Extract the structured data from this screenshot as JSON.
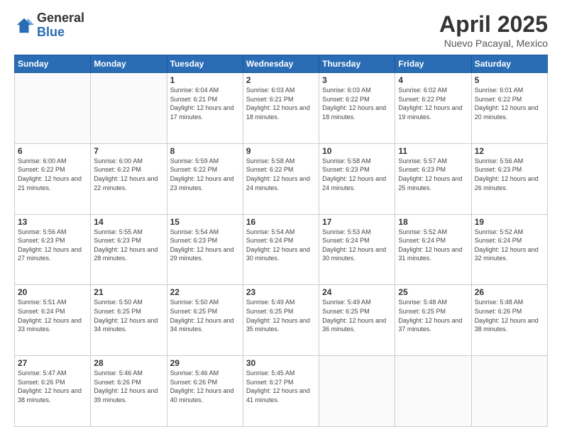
{
  "header": {
    "logo_general": "General",
    "logo_blue": "Blue",
    "main_title": "April 2025",
    "subtitle": "Nuevo Pacayal, Mexico"
  },
  "days_of_week": [
    "Sunday",
    "Monday",
    "Tuesday",
    "Wednesday",
    "Thursday",
    "Friday",
    "Saturday"
  ],
  "weeks": [
    [
      {
        "day": "",
        "info": ""
      },
      {
        "day": "",
        "info": ""
      },
      {
        "day": "1",
        "info": "Sunrise: 6:04 AM\nSunset: 6:21 PM\nDaylight: 12 hours and 17 minutes."
      },
      {
        "day": "2",
        "info": "Sunrise: 6:03 AM\nSunset: 6:21 PM\nDaylight: 12 hours and 18 minutes."
      },
      {
        "day": "3",
        "info": "Sunrise: 6:03 AM\nSunset: 6:22 PM\nDaylight: 12 hours and 18 minutes."
      },
      {
        "day": "4",
        "info": "Sunrise: 6:02 AM\nSunset: 6:22 PM\nDaylight: 12 hours and 19 minutes."
      },
      {
        "day": "5",
        "info": "Sunrise: 6:01 AM\nSunset: 6:22 PM\nDaylight: 12 hours and 20 minutes."
      }
    ],
    [
      {
        "day": "6",
        "info": "Sunrise: 6:00 AM\nSunset: 6:22 PM\nDaylight: 12 hours and 21 minutes."
      },
      {
        "day": "7",
        "info": "Sunrise: 6:00 AM\nSunset: 6:22 PM\nDaylight: 12 hours and 22 minutes."
      },
      {
        "day": "8",
        "info": "Sunrise: 5:59 AM\nSunset: 6:22 PM\nDaylight: 12 hours and 23 minutes."
      },
      {
        "day": "9",
        "info": "Sunrise: 5:58 AM\nSunset: 6:22 PM\nDaylight: 12 hours and 24 minutes."
      },
      {
        "day": "10",
        "info": "Sunrise: 5:58 AM\nSunset: 6:23 PM\nDaylight: 12 hours and 24 minutes."
      },
      {
        "day": "11",
        "info": "Sunrise: 5:57 AM\nSunset: 6:23 PM\nDaylight: 12 hours and 25 minutes."
      },
      {
        "day": "12",
        "info": "Sunrise: 5:56 AM\nSunset: 6:23 PM\nDaylight: 12 hours and 26 minutes."
      }
    ],
    [
      {
        "day": "13",
        "info": "Sunrise: 5:56 AM\nSunset: 6:23 PM\nDaylight: 12 hours and 27 minutes."
      },
      {
        "day": "14",
        "info": "Sunrise: 5:55 AM\nSunset: 6:23 PM\nDaylight: 12 hours and 28 minutes."
      },
      {
        "day": "15",
        "info": "Sunrise: 5:54 AM\nSunset: 6:23 PM\nDaylight: 12 hours and 29 minutes."
      },
      {
        "day": "16",
        "info": "Sunrise: 5:54 AM\nSunset: 6:24 PM\nDaylight: 12 hours and 30 minutes."
      },
      {
        "day": "17",
        "info": "Sunrise: 5:53 AM\nSunset: 6:24 PM\nDaylight: 12 hours and 30 minutes."
      },
      {
        "day": "18",
        "info": "Sunrise: 5:52 AM\nSunset: 6:24 PM\nDaylight: 12 hours and 31 minutes."
      },
      {
        "day": "19",
        "info": "Sunrise: 5:52 AM\nSunset: 6:24 PM\nDaylight: 12 hours and 32 minutes."
      }
    ],
    [
      {
        "day": "20",
        "info": "Sunrise: 5:51 AM\nSunset: 6:24 PM\nDaylight: 12 hours and 33 minutes."
      },
      {
        "day": "21",
        "info": "Sunrise: 5:50 AM\nSunset: 6:25 PM\nDaylight: 12 hours and 34 minutes."
      },
      {
        "day": "22",
        "info": "Sunrise: 5:50 AM\nSunset: 6:25 PM\nDaylight: 12 hours and 34 minutes."
      },
      {
        "day": "23",
        "info": "Sunrise: 5:49 AM\nSunset: 6:25 PM\nDaylight: 12 hours and 35 minutes."
      },
      {
        "day": "24",
        "info": "Sunrise: 5:49 AM\nSunset: 6:25 PM\nDaylight: 12 hours and 36 minutes."
      },
      {
        "day": "25",
        "info": "Sunrise: 5:48 AM\nSunset: 6:25 PM\nDaylight: 12 hours and 37 minutes."
      },
      {
        "day": "26",
        "info": "Sunrise: 5:48 AM\nSunset: 6:26 PM\nDaylight: 12 hours and 38 minutes."
      }
    ],
    [
      {
        "day": "27",
        "info": "Sunrise: 5:47 AM\nSunset: 6:26 PM\nDaylight: 12 hours and 38 minutes."
      },
      {
        "day": "28",
        "info": "Sunrise: 5:46 AM\nSunset: 6:26 PM\nDaylight: 12 hours and 39 minutes."
      },
      {
        "day": "29",
        "info": "Sunrise: 5:46 AM\nSunset: 6:26 PM\nDaylight: 12 hours and 40 minutes."
      },
      {
        "day": "30",
        "info": "Sunrise: 5:45 AM\nSunset: 6:27 PM\nDaylight: 12 hours and 41 minutes."
      },
      {
        "day": "",
        "info": ""
      },
      {
        "day": "",
        "info": ""
      },
      {
        "day": "",
        "info": ""
      }
    ]
  ]
}
